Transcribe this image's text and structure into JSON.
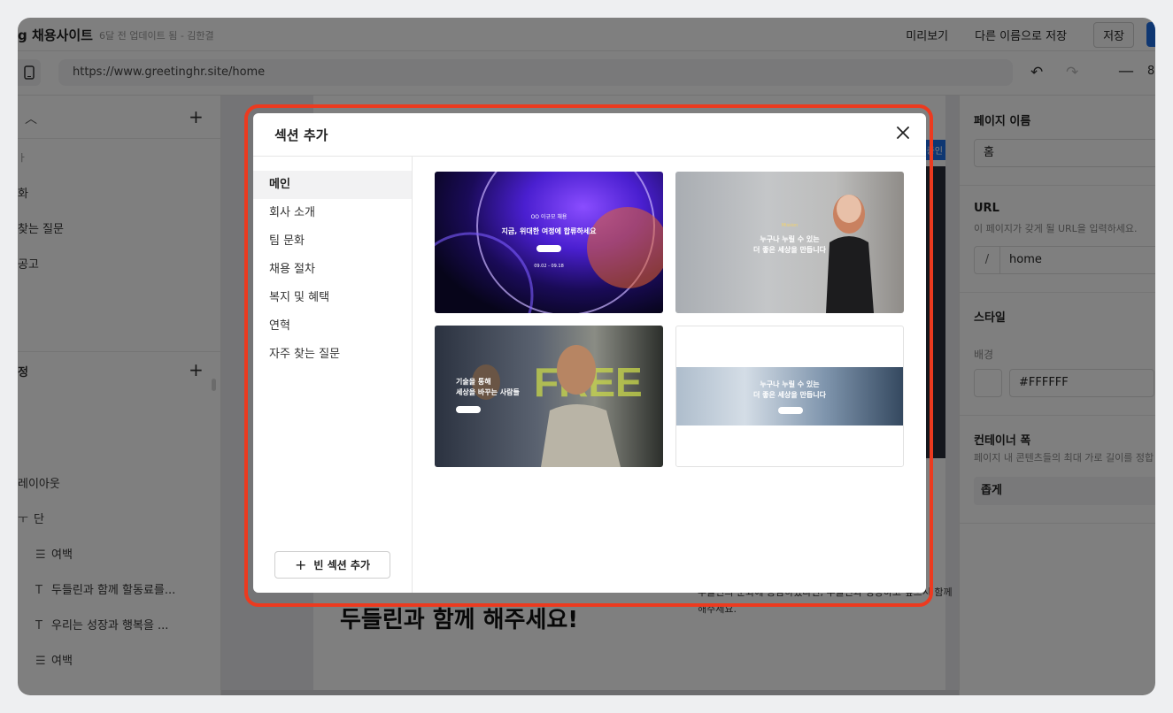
{
  "header": {
    "site_title": "g 채용사이트",
    "updated": "6달 전 업데이트 됨 - 김한결",
    "preview_label": "미리보기",
    "save_as_label": "다른 이름으로 저장",
    "save_label": "저장"
  },
  "address_bar": {
    "url": "https://www.greetinghr.site/home",
    "zoom": "8"
  },
  "left_panel": {
    "pages_partial": [
      "ㅏ",
      "화",
      "찾는 질문",
      "공고"
    ],
    "section_header": "정",
    "tree": [
      {
        "label": "레이아웃"
      },
      {
        "label": "단"
      },
      {
        "label": "여백",
        "icon": "spacer-icon"
      },
      {
        "label": "두들린과 함께 할동료를...",
        "icon": "text-icon"
      },
      {
        "label": "우리는 성장과 행복을 ...",
        "icon": "text-icon"
      },
      {
        "label": "여백",
        "icon": "spacer-icon"
      }
    ]
  },
  "canvas": {
    "heading": "두들린과 함께 해주세요!",
    "body_text": "두들린의 문화에 공감하셨다면, 두들린과 성장하고 싶으시 함께 해주세요.",
    "badge": "중인"
  },
  "right_panel": {
    "page_name_label": "페이지 이름",
    "page_name_value": "홈",
    "url_label": "URL",
    "url_help": "이 페이지가 갖게 될 URL을 입력하세요.",
    "url_prefix": "/",
    "url_value": "home",
    "style_label": "스타일",
    "background_label": "배경",
    "background_value": "#FFFFFF",
    "container_label": "컨테이너 폭",
    "container_help": "페이지 내 콘텐츠들의 최대 가로 길이를 정합",
    "container_value": "좁게"
  },
  "modal": {
    "title": "섹션 추가",
    "categories": [
      "메인",
      "회사 소개",
      "팀 문화",
      "채용 절차",
      "복지 및 혜택",
      "연혁",
      "자주 찾는 질문"
    ],
    "active_category": "메인",
    "add_empty_label": "빈 섹션 추가",
    "templates": [
      {
        "line1": "OO 이규모 채용",
        "line2": "지금, 위대한 여정에 합류하세요",
        "date": "09.02 - 09.18"
      },
      {
        "kicker": "Mission",
        "line1": "누구나 누릴 수 있는",
        "line2": "더 좋은 세상을 만듭니다"
      },
      {
        "line1": "기술을 통해",
        "line2": "세상을 바꾸는 사람들"
      },
      {
        "line1": "누구나 누릴 수 있는",
        "line2": "더 좋은 세상을 만듭니다"
      }
    ]
  },
  "colors": {
    "accent": "#1f6fe5",
    "highlight": "#ec3a1f"
  }
}
